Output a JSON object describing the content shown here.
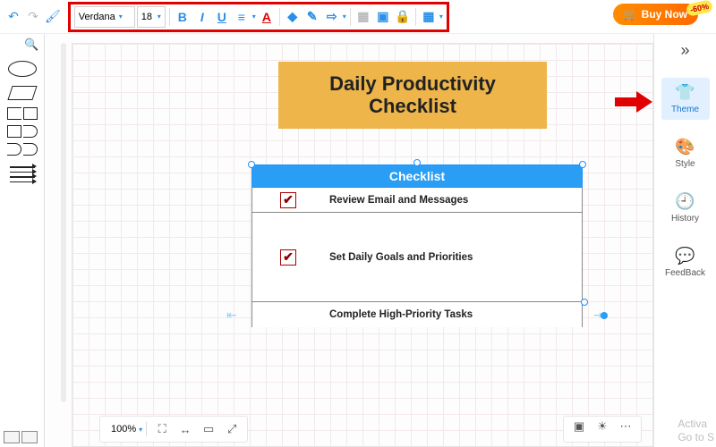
{
  "toolbar": {
    "font": "Verdana",
    "size": "18",
    "bold": "B",
    "italic": "I",
    "underline": "U",
    "align": "≡",
    "text_color": "A",
    "fill": "◆",
    "line": "✎",
    "connector": "⇨",
    "img1": "▦",
    "img2": "▣",
    "lock": "🔒",
    "grid": "▦"
  },
  "buy": {
    "label": "Buy Now",
    "badge": "-60%"
  },
  "canvas": {
    "title": "Daily Productivity Checklist",
    "table_header": "Checklist",
    "rows": [
      {
        "checked": true,
        "task": "Review Email and Messages"
      },
      {
        "checked": true,
        "task": "Set Daily Goals and Priorities"
      },
      {
        "checked": false,
        "task": "Complete High-Priority Tasks"
      }
    ]
  },
  "bottom": {
    "zoom": "100%"
  },
  "sidebar": {
    "items": [
      {
        "label": "Theme"
      },
      {
        "label": "Style"
      },
      {
        "label": "History"
      },
      {
        "label": "FeedBack"
      }
    ]
  },
  "watermark": {
    "l1": "Activa",
    "l2": "Go to S"
  }
}
